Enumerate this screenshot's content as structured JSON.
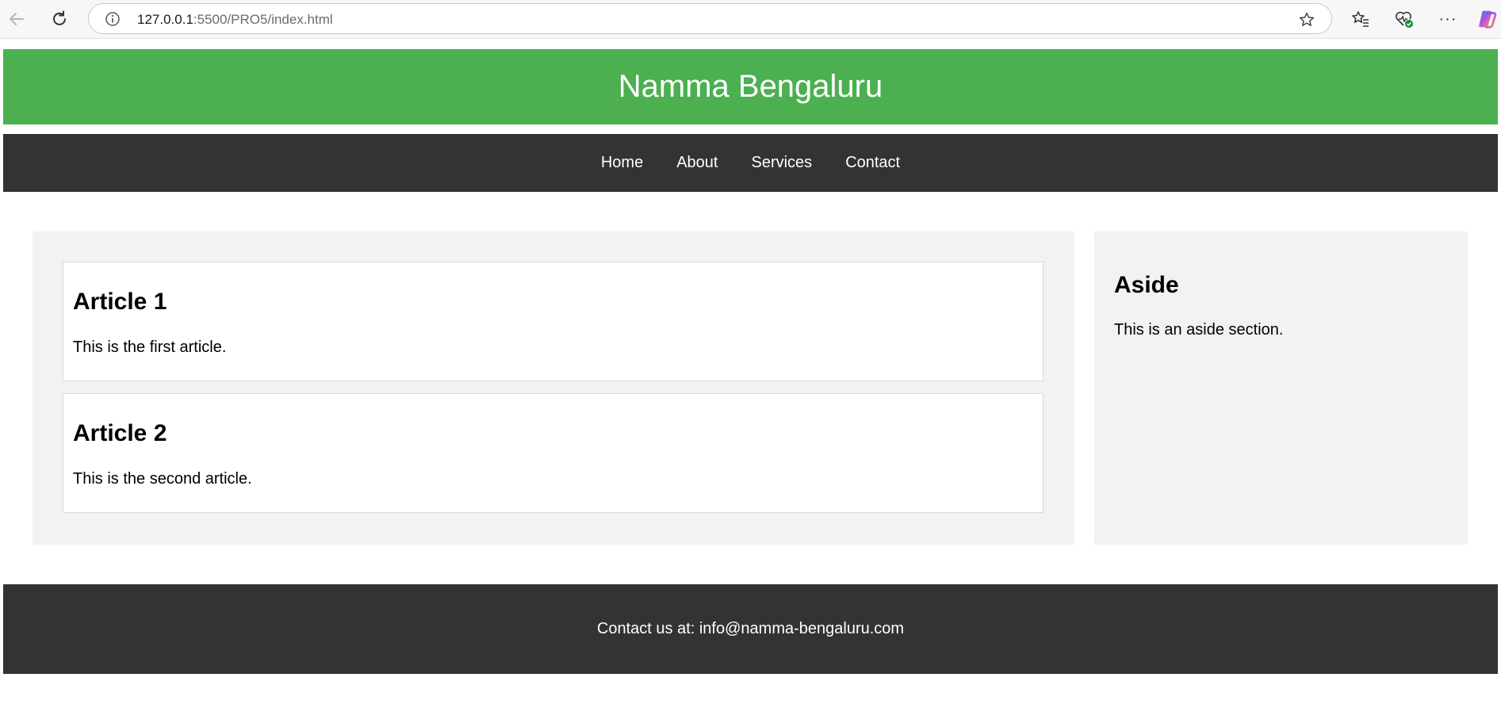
{
  "browser": {
    "url_host": "127.0.0.1",
    "url_rest": ":5500/PRO5/index.html",
    "icons": {
      "back": "back-arrow-icon",
      "reload": "reload-icon",
      "info": "info-icon",
      "star": "star-icon",
      "favorites": "favorites-icon",
      "health": "browser-essentials-icon",
      "more": "more-icon",
      "copilot": "copilot-icon"
    },
    "more_glyph": "···"
  },
  "header": {
    "title": "Namma Bengaluru",
    "color": "#4caf50"
  },
  "nav": {
    "items": [
      {
        "label": "Home"
      },
      {
        "label": "About"
      },
      {
        "label": "Services"
      },
      {
        "label": "Contact"
      }
    ],
    "color": "#333333"
  },
  "main": {
    "articles": [
      {
        "title": "Article 1",
        "text": "This is the first article."
      },
      {
        "title": "Article 2",
        "text": "This is the second article."
      }
    ]
  },
  "aside": {
    "title": "Aside",
    "text": "This is an aside section."
  },
  "footer": {
    "text": "Contact us at: info@namma-bengaluru.com"
  }
}
